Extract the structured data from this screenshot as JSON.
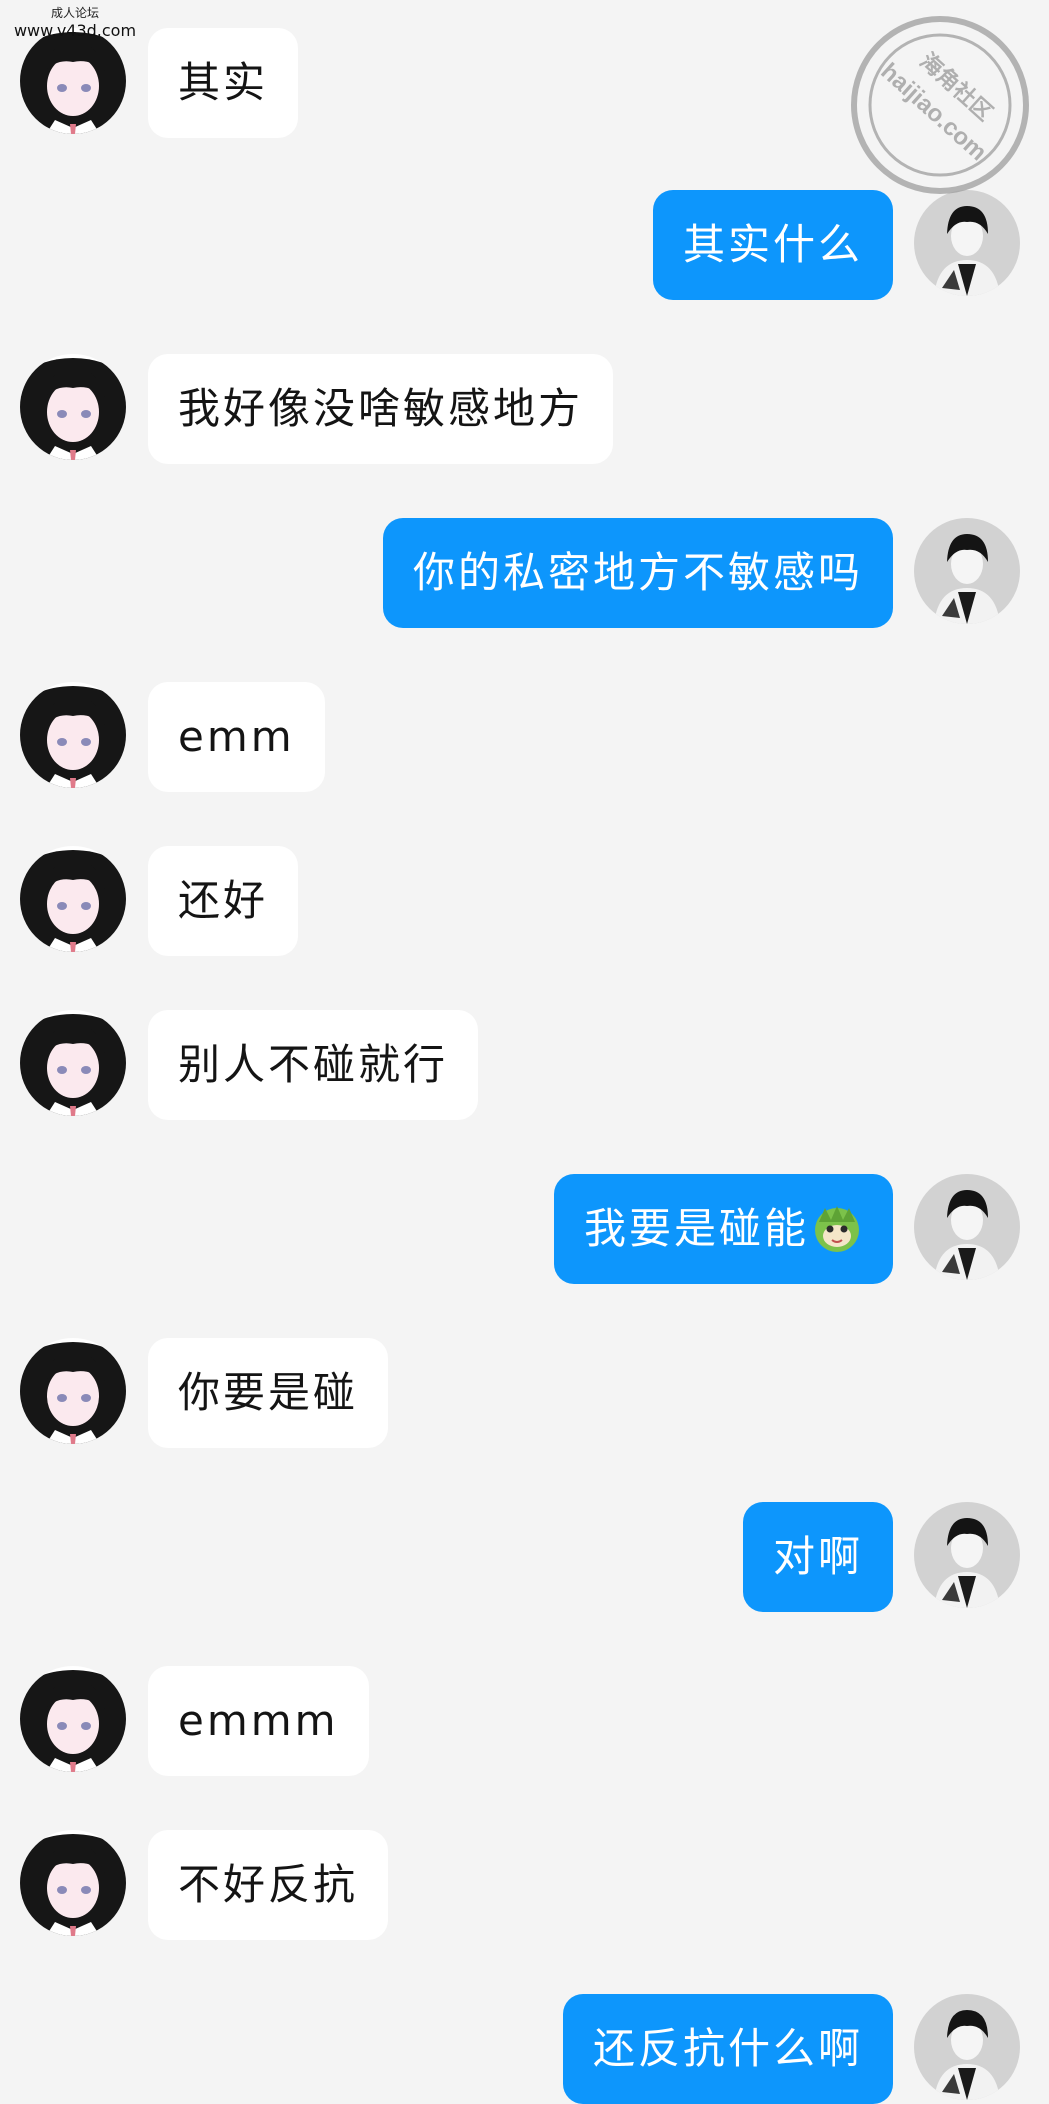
{
  "watermark": {
    "top_left_line1": "成人论坛",
    "top_left_line2": "www.v43d.com",
    "top_right_line1": "海角社区",
    "top_right_line2": "haijiao.com"
  },
  "colors": {
    "background": "#f4f4f4",
    "incoming_bubble": "#ffffff",
    "outgoing_bubble": "#0d96fc",
    "incoming_text": "#141414",
    "outgoing_text": "#ffffff"
  },
  "messages": [
    {
      "sender": "other",
      "text": "其实"
    },
    {
      "sender": "me",
      "text": "其实什么"
    },
    {
      "sender": "other",
      "text": "我好像没啥敏感地方"
    },
    {
      "sender": "me",
      "text": "你的私密地方不敏感吗"
    },
    {
      "sender": "other",
      "text": "emm"
    },
    {
      "sender": "other",
      "text": "还好"
    },
    {
      "sender": "other",
      "text": "别人不碰就行"
    },
    {
      "sender": "me",
      "text": "我要是碰能",
      "emoji": "sticker-emoji-icon"
    },
    {
      "sender": "other",
      "text": "你要是碰"
    },
    {
      "sender": "me",
      "text": "对啊"
    },
    {
      "sender": "other",
      "text": "emmm"
    },
    {
      "sender": "other",
      "text": "不好反抗"
    },
    {
      "sender": "me",
      "text": "还反抗什么啊"
    }
  ]
}
